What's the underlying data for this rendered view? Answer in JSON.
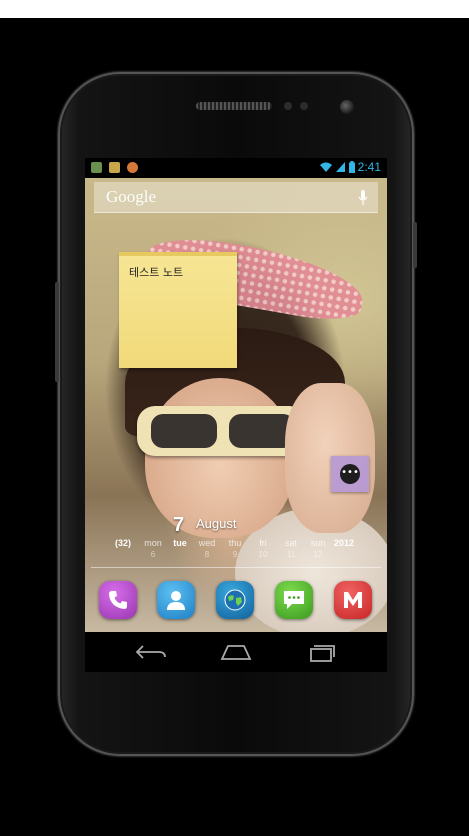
{
  "status_bar": {
    "time": "2:41",
    "notifications": [
      "image-notification-icon",
      "message-notification-icon",
      "app-notification-icon"
    ],
    "indicators": [
      "wifi-icon",
      "signal-icon",
      "battery-icon"
    ]
  },
  "search": {
    "logo": "Google",
    "mic_icon": "microphone-icon"
  },
  "sticky_note": {
    "text": "테스트 노트"
  },
  "floating_widget": {
    "icon": "more-dots-icon"
  },
  "calendar_widget": {
    "day": "7",
    "month": "August",
    "week_count": "(32)",
    "year": "2012",
    "weekdays": [
      {
        "name": "mon",
        "num": "6"
      },
      {
        "name": "tue",
        "num": ""
      },
      {
        "name": "wed",
        "num": "8"
      },
      {
        "name": "thu",
        "num": "9"
      },
      {
        "name": "fri",
        "num": "10"
      },
      {
        "name": "sat",
        "num": "11"
      },
      {
        "name": "sun",
        "num": "12"
      }
    ],
    "active_day": "tue"
  },
  "dock": {
    "apps": [
      {
        "name": "Phone",
        "icon": "phone-icon",
        "color": "#b04cc4"
      },
      {
        "name": "Contacts",
        "icon": "contacts-icon",
        "color": "#2e9be0"
      },
      {
        "name": "Browser",
        "icon": "globe-icon",
        "color": "#1e88c8"
      },
      {
        "name": "Messaging",
        "icon": "message-icon",
        "color": "#4caf2f"
      },
      {
        "name": "Gmail",
        "icon": "gmail-icon",
        "color": "#e33b3b"
      }
    ]
  },
  "nav": {
    "buttons": [
      "back-icon",
      "home-icon",
      "recent-apps-icon"
    ]
  },
  "colors": {
    "clock_blue": "#33b5e5",
    "sticky_yellow": "#f3e088",
    "float_purple": "#b698d6"
  }
}
